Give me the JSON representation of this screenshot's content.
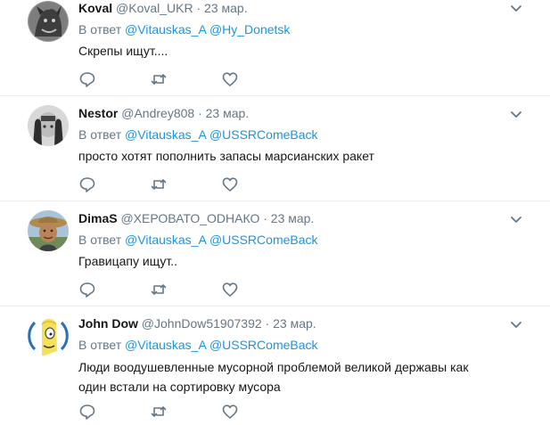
{
  "tweets": [
    {
      "name": "Koval",
      "handle": "@Koval_UKR",
      "dot": "·",
      "date": "23 мар.",
      "reply_prefix": "В ответ",
      "mentions": [
        "@Vitauskas_A",
        "@Hy_Donetsk"
      ],
      "text": "Скрепы ищут....",
      "avatar_icon": "gargoyle-avatar"
    },
    {
      "name": "Nestor",
      "handle": "@Andrey808",
      "dot": "·",
      "date": "23 мар.",
      "reply_prefix": "В ответ",
      "mentions": [
        "@Vitauskas_A",
        "@USSRComeBack"
      ],
      "text": "просто хотят пополнить запасы марсианских ракет",
      "avatar_icon": "hands-face-avatar"
    },
    {
      "name": "DimaS",
      "handle": "@ХЕРОВАТО_ОDНАКО",
      "dot": "·",
      "date": "23 мар.",
      "reply_prefix": "В ответ",
      "mentions": [
        "@Vitauskas_A",
        "@USSRComeBack"
      ],
      "text": "Гравицапу ищут..",
      "avatar_icon": "hat-man-avatar"
    },
    {
      "name": "John Dow",
      "handle": "@JohnDow51907392",
      "dot": "·",
      "date": "23 мар.",
      "reply_prefix": "В ответ",
      "mentions": [
        "@Vitauskas_A",
        "@USSRComeBack"
      ],
      "text": "Люди воодушевленные мусорной проблемой великой державы как один встали на сортировку мусора",
      "avatar_icon": "cartoon-blond-avatar"
    }
  ],
  "colors": {
    "link": "#1b95e0",
    "muted": "#657786",
    "divider": "#e6ecf0"
  },
  "icons": [
    "reply-icon",
    "retweet-icon",
    "like-icon",
    "chevron-down-icon"
  ]
}
